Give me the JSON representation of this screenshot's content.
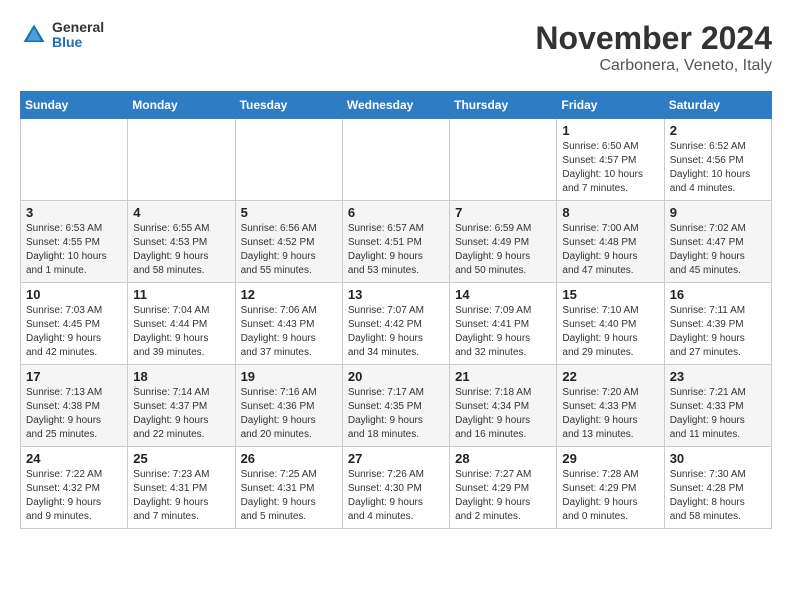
{
  "header": {
    "logo_general": "General",
    "logo_blue": "Blue",
    "month_title": "November 2024",
    "subtitle": "Carbonera, Veneto, Italy"
  },
  "weekdays": [
    "Sunday",
    "Monday",
    "Tuesday",
    "Wednesday",
    "Thursday",
    "Friday",
    "Saturday"
  ],
  "weeks": [
    [
      {
        "day": "",
        "info": ""
      },
      {
        "day": "",
        "info": ""
      },
      {
        "day": "",
        "info": ""
      },
      {
        "day": "",
        "info": ""
      },
      {
        "day": "",
        "info": ""
      },
      {
        "day": "1",
        "info": "Sunrise: 6:50 AM\nSunset: 4:57 PM\nDaylight: 10 hours\nand 7 minutes."
      },
      {
        "day": "2",
        "info": "Sunrise: 6:52 AM\nSunset: 4:56 PM\nDaylight: 10 hours\nand 4 minutes."
      }
    ],
    [
      {
        "day": "3",
        "info": "Sunrise: 6:53 AM\nSunset: 4:55 PM\nDaylight: 10 hours\nand 1 minute."
      },
      {
        "day": "4",
        "info": "Sunrise: 6:55 AM\nSunset: 4:53 PM\nDaylight: 9 hours\nand 58 minutes."
      },
      {
        "day": "5",
        "info": "Sunrise: 6:56 AM\nSunset: 4:52 PM\nDaylight: 9 hours\nand 55 minutes."
      },
      {
        "day": "6",
        "info": "Sunrise: 6:57 AM\nSunset: 4:51 PM\nDaylight: 9 hours\nand 53 minutes."
      },
      {
        "day": "7",
        "info": "Sunrise: 6:59 AM\nSunset: 4:49 PM\nDaylight: 9 hours\nand 50 minutes."
      },
      {
        "day": "8",
        "info": "Sunrise: 7:00 AM\nSunset: 4:48 PM\nDaylight: 9 hours\nand 47 minutes."
      },
      {
        "day": "9",
        "info": "Sunrise: 7:02 AM\nSunset: 4:47 PM\nDaylight: 9 hours\nand 45 minutes."
      }
    ],
    [
      {
        "day": "10",
        "info": "Sunrise: 7:03 AM\nSunset: 4:45 PM\nDaylight: 9 hours\nand 42 minutes."
      },
      {
        "day": "11",
        "info": "Sunrise: 7:04 AM\nSunset: 4:44 PM\nDaylight: 9 hours\nand 39 minutes."
      },
      {
        "day": "12",
        "info": "Sunrise: 7:06 AM\nSunset: 4:43 PM\nDaylight: 9 hours\nand 37 minutes."
      },
      {
        "day": "13",
        "info": "Sunrise: 7:07 AM\nSunset: 4:42 PM\nDaylight: 9 hours\nand 34 minutes."
      },
      {
        "day": "14",
        "info": "Sunrise: 7:09 AM\nSunset: 4:41 PM\nDaylight: 9 hours\nand 32 minutes."
      },
      {
        "day": "15",
        "info": "Sunrise: 7:10 AM\nSunset: 4:40 PM\nDaylight: 9 hours\nand 29 minutes."
      },
      {
        "day": "16",
        "info": "Sunrise: 7:11 AM\nSunset: 4:39 PM\nDaylight: 9 hours\nand 27 minutes."
      }
    ],
    [
      {
        "day": "17",
        "info": "Sunrise: 7:13 AM\nSunset: 4:38 PM\nDaylight: 9 hours\nand 25 minutes."
      },
      {
        "day": "18",
        "info": "Sunrise: 7:14 AM\nSunset: 4:37 PM\nDaylight: 9 hours\nand 22 minutes."
      },
      {
        "day": "19",
        "info": "Sunrise: 7:16 AM\nSunset: 4:36 PM\nDaylight: 9 hours\nand 20 minutes."
      },
      {
        "day": "20",
        "info": "Sunrise: 7:17 AM\nSunset: 4:35 PM\nDaylight: 9 hours\nand 18 minutes."
      },
      {
        "day": "21",
        "info": "Sunrise: 7:18 AM\nSunset: 4:34 PM\nDaylight: 9 hours\nand 16 minutes."
      },
      {
        "day": "22",
        "info": "Sunrise: 7:20 AM\nSunset: 4:33 PM\nDaylight: 9 hours\nand 13 minutes."
      },
      {
        "day": "23",
        "info": "Sunrise: 7:21 AM\nSunset: 4:33 PM\nDaylight: 9 hours\nand 11 minutes."
      }
    ],
    [
      {
        "day": "24",
        "info": "Sunrise: 7:22 AM\nSunset: 4:32 PM\nDaylight: 9 hours\nand 9 minutes."
      },
      {
        "day": "25",
        "info": "Sunrise: 7:23 AM\nSunset: 4:31 PM\nDaylight: 9 hours\nand 7 minutes."
      },
      {
        "day": "26",
        "info": "Sunrise: 7:25 AM\nSunset: 4:31 PM\nDaylight: 9 hours\nand 5 minutes."
      },
      {
        "day": "27",
        "info": "Sunrise: 7:26 AM\nSunset: 4:30 PM\nDaylight: 9 hours\nand 4 minutes."
      },
      {
        "day": "28",
        "info": "Sunrise: 7:27 AM\nSunset: 4:29 PM\nDaylight: 9 hours\nand 2 minutes."
      },
      {
        "day": "29",
        "info": "Sunrise: 7:28 AM\nSunset: 4:29 PM\nDaylight: 9 hours\nand 0 minutes."
      },
      {
        "day": "30",
        "info": "Sunrise: 7:30 AM\nSunset: 4:28 PM\nDaylight: 8 hours\nand 58 minutes."
      }
    ]
  ]
}
